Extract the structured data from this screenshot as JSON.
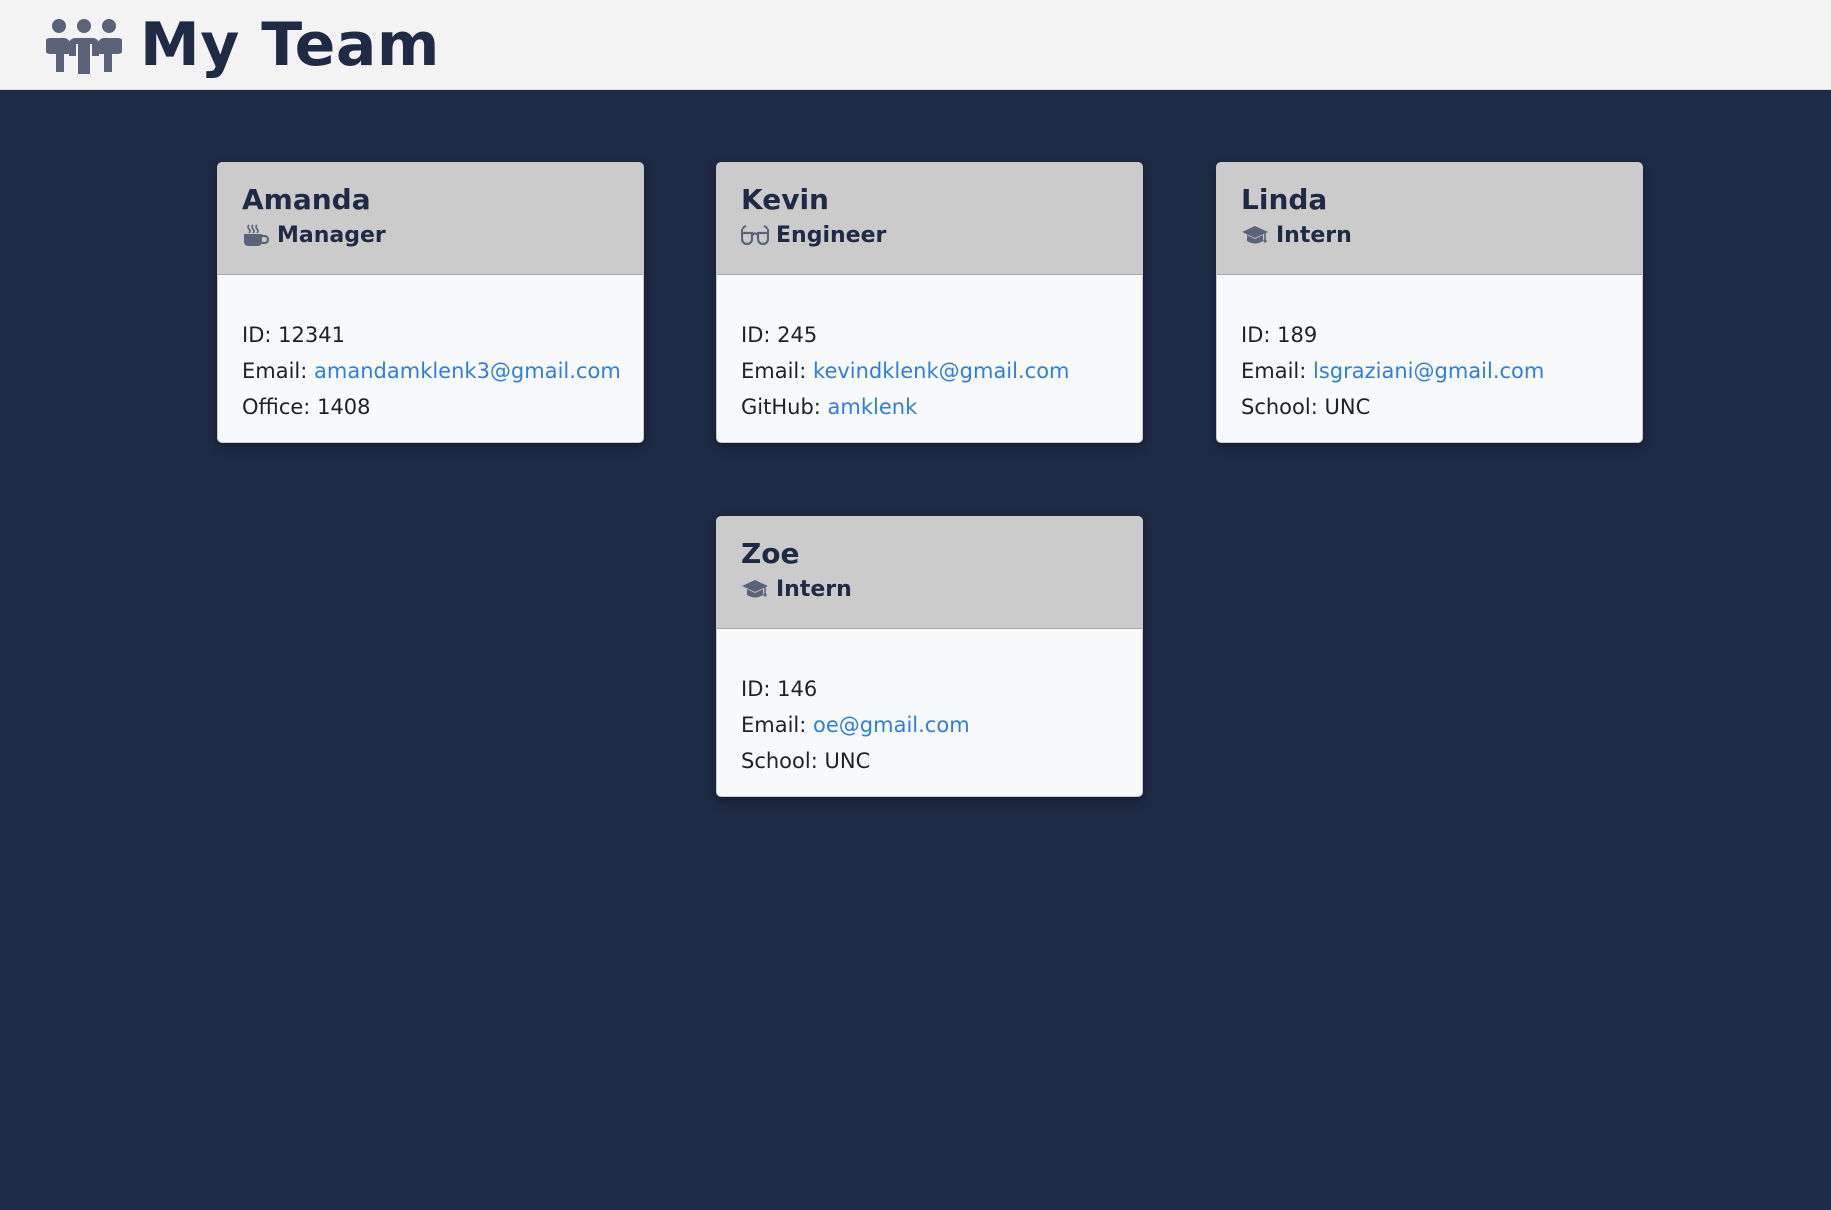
{
  "header": {
    "title": "My Team",
    "icon": "users-icon"
  },
  "colors": {
    "background": "#1f2a45",
    "header_bg": "#f3f3f3",
    "card_header_bg": "#cbcbcb",
    "link": "#2f7fe0"
  },
  "employees": [
    {
      "name": "Amanda",
      "role": "Manager",
      "role_icon": "mug-icon",
      "id_label": "ID:",
      "id_value": "12341",
      "email_label": "Email:",
      "email_value": "amandamklenk3@gmail.com",
      "extra_label": "Office:",
      "extra_value": "1408"
    },
    {
      "name": "Kevin",
      "role": "Engineer",
      "role_icon": "glasses-icon",
      "id_label": "ID:",
      "id_value": "245",
      "email_label": "Email:",
      "email_value": "kevindklenk@gmail.com",
      "extra_label": "GitHub:",
      "extra_value": "amklenk"
    },
    {
      "name": "Linda",
      "role": "Intern",
      "role_icon": "graduation-cap-icon",
      "id_label": "ID:",
      "id_value": "189",
      "email_label": "Email:",
      "email_value": "lsgraziani@gmail.com",
      "extra_label": "School:",
      "extra_value": "UNC"
    },
    {
      "name": "Zoe",
      "role": "Intern",
      "role_icon": "graduation-cap-icon",
      "id_label": "ID:",
      "id_value": "146",
      "email_label": "Email:",
      "email_value": "oe@gmail.com",
      "extra_label": "School:",
      "extra_value": "UNC"
    }
  ]
}
